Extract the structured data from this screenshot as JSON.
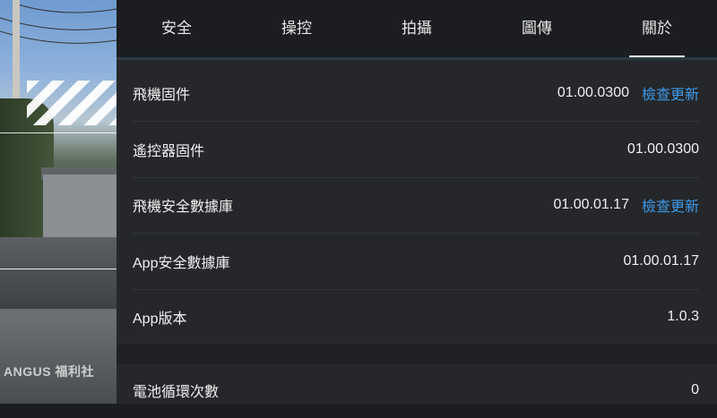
{
  "tabs": [
    {
      "label": "安全"
    },
    {
      "label": "操控"
    },
    {
      "label": "拍攝"
    },
    {
      "label": "圖傳"
    },
    {
      "label": "關於",
      "active": true
    }
  ],
  "rows": [
    {
      "label": "飛機固件",
      "value": "01.00.0300",
      "action": "檢查更新"
    },
    {
      "label": "遙控器固件",
      "value": "01.00.0300"
    },
    {
      "label": "飛機安全數據庫",
      "value": "01.00.01.17",
      "action": "檢查更新"
    },
    {
      "label": "App安全數據庫",
      "value": "01.00.01.17"
    },
    {
      "label": "App版本",
      "value": "1.0.3"
    },
    {
      "label": "電池循環次數",
      "value": "0"
    }
  ],
  "watermark": "ANGUS 福利社",
  "colors": {
    "accent": "#3d9ae8",
    "background": "#25272b",
    "tabbar": "#1b1d20"
  }
}
